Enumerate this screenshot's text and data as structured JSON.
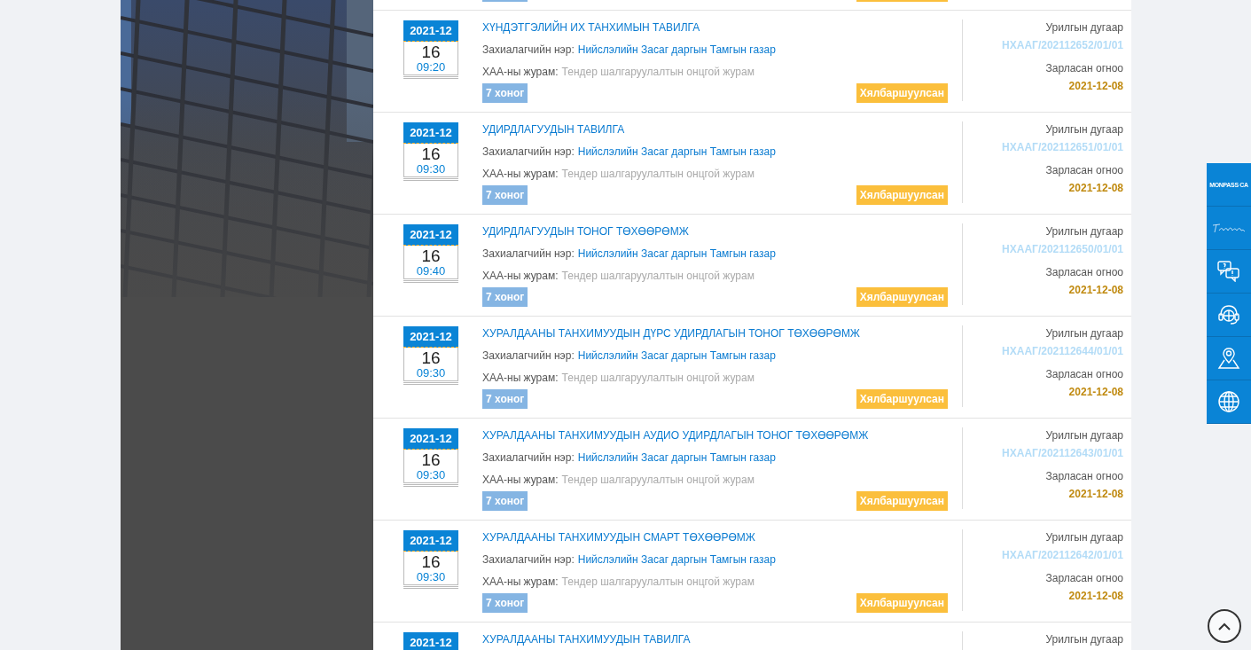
{
  "tenders": [
    {
      "kind": "partial_top"
    },
    {
      "kind": "full",
      "month": "2021-12",
      "day": "16",
      "time": "09:20",
      "title": "ХҮНДЭТГЭЛИЙН ИХ ТАНХИМЫН ТАВИЛГА",
      "customer_label": "Захиалагчийн нэр:",
      "customer": "Нийслэлийн Засаг даргын Тамгын газар",
      "procedure_label": "ХАА-ны журам:",
      "procedure": "Тендер шалгаруулалтын онцгой журам",
      "duration": "7 хоног",
      "type": "Хялбаршуулсан",
      "invite_label": "Урилгын дугаар",
      "invite_no": "НХААГ/202112652/01/01",
      "date_label": "Зарласан огноо",
      "posted": "2021-12-08"
    },
    {
      "kind": "full",
      "month": "2021-12",
      "day": "16",
      "time": "09:30",
      "title": "УДИРДЛАГУУДЫН ТАВИЛГА",
      "customer_label": "Захиалагчийн нэр:",
      "customer": "Нийслэлийн Засаг даргын Тамгын газар",
      "procedure_label": "ХАА-ны журам:",
      "procedure": "Тендер шалгаруулалтын онцгой журам",
      "duration": "7 хоног",
      "type": "Хялбаршуулсан",
      "invite_label": "Урилгын дугаар",
      "invite_no": "НХААГ/202112651/01/01",
      "date_label": "Зарласан огноо",
      "posted": "2021-12-08"
    },
    {
      "kind": "full",
      "month": "2021-12",
      "day": "16",
      "time": "09:40",
      "title": "УДИРДЛАГУУДЫН ТОНОГ ТӨХӨӨРӨМЖ",
      "customer_label": "Захиалагчийн нэр:",
      "customer": "Нийслэлийн Засаг даргын Тамгын газар",
      "procedure_label": "ХАА-ны журам:",
      "procedure": "Тендер шалгаруулалтын онцгой журам",
      "duration": "7 хоног",
      "type": "Хялбаршуулсан",
      "invite_label": "Урилгын дугаар",
      "invite_no": "НХААГ/202112650/01/01",
      "date_label": "Зарласан огноо",
      "posted": "2021-12-08"
    },
    {
      "kind": "full",
      "month": "2021-12",
      "day": "16",
      "time": "09:30",
      "title": "ХУРАЛДААНЫ ТАНХИМУУДЫН ДҮРС УДИРДЛАГЫН ТОНОГ ТӨХӨӨРӨМЖ",
      "customer_label": "Захиалагчийн нэр:",
      "customer": "Нийслэлийн Засаг даргын Тамгын газар",
      "procedure_label": "ХАА-ны журам:",
      "procedure": "Тендер шалгаруулалтын онцгой журам",
      "duration": "7 хоног",
      "type": "Хялбаршуулсан",
      "invite_label": "Урилгын дугаар",
      "invite_no": "НХААГ/202112644/01/01",
      "date_label": "Зарласан огноо",
      "posted": "2021-12-08"
    },
    {
      "kind": "full",
      "month": "2021-12",
      "day": "16",
      "time": "09:30",
      "title": "ХУРАЛДААНЫ ТАНХИМУУДЫН АУДИО УДИРДЛАГЫН ТОНОГ ТӨХӨӨРӨМЖ",
      "customer_label": "Захиалагчийн нэр:",
      "customer": "Нийслэлийн Засаг даргын Тамгын газар",
      "procedure_label": "ХАА-ны журам:",
      "procedure": "Тендер шалгаруулалтын онцгой журам",
      "duration": "7 хоног",
      "type": "Хялбаршуулсан",
      "invite_label": "Урилгын дугаар",
      "invite_no": "НХААГ/202112643/01/01",
      "date_label": "Зарласан огноо",
      "posted": "2021-12-08"
    },
    {
      "kind": "full",
      "month": "2021-12",
      "day": "16",
      "time": "09:30",
      "title": "ХУРАЛДААНЫ ТАНХИМУУДЫН СМАРТ ТӨХӨӨРӨМЖ",
      "customer_label": "Захиалагчийн нэр:",
      "customer": "Нийслэлийн Засаг даргын Тамгын газар",
      "procedure_label": "ХАА-ны журам:",
      "procedure": "Тендер шалгаруулалтын онцгой журам",
      "duration": "7 хоног",
      "type": "Хялбаршуулсан",
      "invite_label": "Урилгын дугаар",
      "invite_no": "НХААГ/202112642/01/01",
      "date_label": "Зарласан огноо",
      "posted": "2021-12-08"
    },
    {
      "kind": "partial_bottom",
      "month": "2021-12",
      "title": "ХУРАЛДААНЫ ТАНХИМУУДЫН ТАВИЛГА",
      "invite_label": "Урилгын дугаар"
    }
  ],
  "side_buttons": [
    {
      "kind": "monpass",
      "text": "MONPASS CA"
    },
    {
      "kind": "script_logo"
    },
    {
      "kind": "chat"
    },
    {
      "kind": "support"
    },
    {
      "kind": "location"
    },
    {
      "kind": "globe"
    }
  ],
  "scroll_top": {
    "kind": "up"
  }
}
